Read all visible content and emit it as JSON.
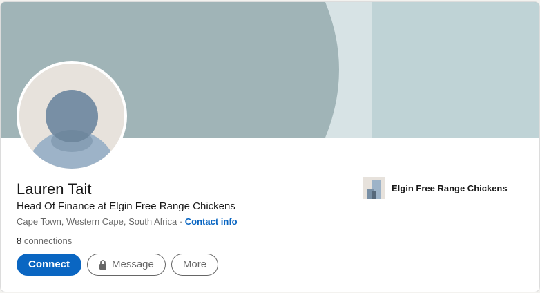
{
  "profile": {
    "name": "Lauren Tait",
    "headline": "Head Of Finance at Elgin Free Range Chickens",
    "location": "Cape Town, Western Cape, South Africa",
    "separator": " · ",
    "contact_info_label": "Contact info",
    "connections_count": "8",
    "connections_label": " connections"
  },
  "actions": {
    "connect_label": "Connect",
    "message_label": "Message",
    "more_label": "More"
  },
  "company": {
    "name": "Elgin Free Range Chickens",
    "logo_icon": "company-logo-placeholder-icon"
  },
  "colors": {
    "accent": "#0a66c2",
    "banner_base": "#a0b4b7",
    "banner_light": "#d7e3e5",
    "banner_right": "#bfd3d6",
    "avatar_bg": "#e7e2dc",
    "avatar_head": "#788fa5",
    "avatar_body": "#9db3c8"
  }
}
